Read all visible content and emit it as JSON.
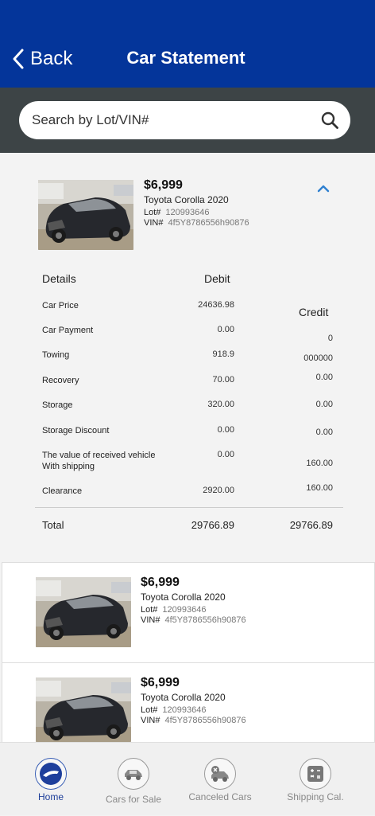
{
  "header": {
    "back_label": "Back",
    "title": "Car Statement"
  },
  "search": {
    "placeholder": "Search by Lot/VIN#"
  },
  "expanded_card": {
    "price": "$6,999",
    "model": "Toyota Corolla 2020",
    "lot_label": "Lot#",
    "lot_value": "120993646",
    "vin_label": "VIN#",
    "vin_value": "4f5Y8786556h90876"
  },
  "statement": {
    "col_details": "Details",
    "col_debit": "Debit",
    "col_credit": "Credit",
    "rows": [
      {
        "label": "Car Price",
        "debit": "24636.98",
        "credit": ""
      },
      {
        "label": "Car Payment",
        "debit": "0.00",
        "credit": "0"
      },
      {
        "label": "Towing",
        "debit": "918.9",
        "credit": "000000"
      },
      {
        "label": "Recovery",
        "debit": "70.00",
        "credit": "0.00"
      },
      {
        "label": "Storage",
        "debit": "320.00",
        "credit": "0.00"
      },
      {
        "label": "Storage Discount",
        "debit": "0.00",
        "credit": "0.00"
      },
      {
        "label": "The value of received vehicle",
        "label2": "With shipping",
        "debit": "0.00",
        "credit": "160.00"
      },
      {
        "label": "Clearance",
        "debit": "2920.00",
        "credit": "160.00"
      }
    ],
    "total_label": "Total",
    "total_debit": "29766.89",
    "total_credit": "29766.89"
  },
  "cards": [
    {
      "price": "$6,999",
      "model": "Toyota Corolla 2020",
      "lot_label": "Lot#",
      "lot_value": "120993646",
      "vin_label": "VIN#",
      "vin_value": "4f5Y8786556h90876"
    },
    {
      "price": "$6,999",
      "model": "Toyota Corolla 2020",
      "lot_label": "Lot#",
      "lot_value": "120993646",
      "vin_label": "VIN#",
      "vin_value": "4f5Y8786556h90876"
    }
  ],
  "tabs": [
    {
      "label": "Home",
      "icon": "home-logo-icon",
      "active": true
    },
    {
      "label": "Cars for Sale",
      "icon": "car-for-sale-icon",
      "active": false
    },
    {
      "label": "Canceled Cars",
      "icon": "canceled-car-icon",
      "active": false
    },
    {
      "label": "Shipping Cal.",
      "icon": "calculator-icon",
      "active": false
    }
  ],
  "colors": {
    "header": "#04359a",
    "search_band": "#3d4446",
    "accent": "#2f80d0"
  }
}
